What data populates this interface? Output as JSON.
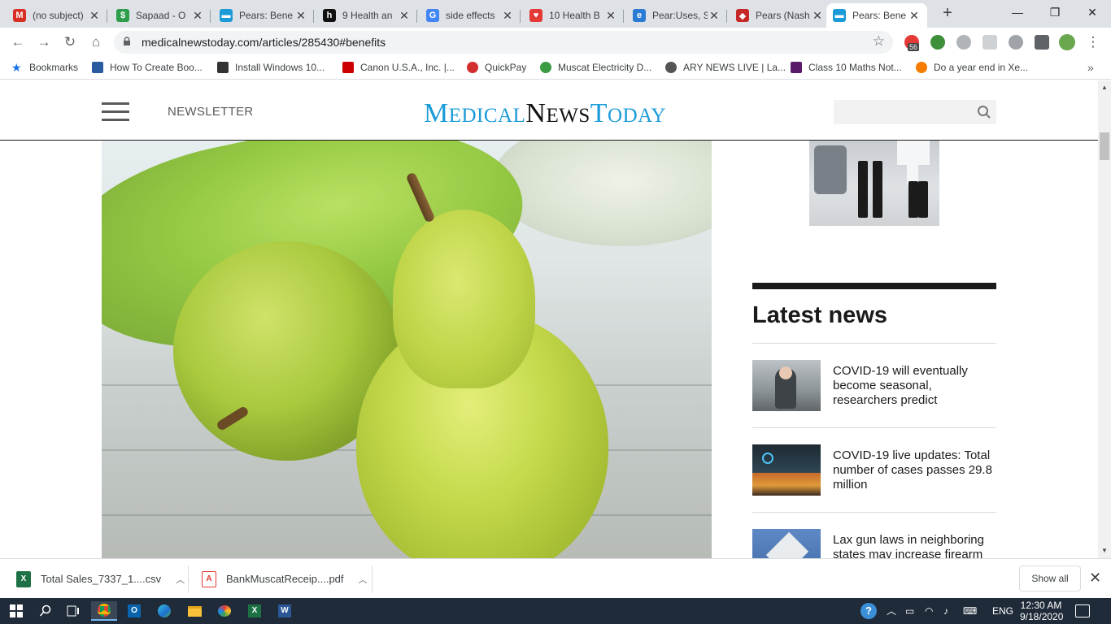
{
  "browser": {
    "tabs": [
      {
        "title": "(no subject)",
        "icon": "gmail-icon",
        "color": "#d93025",
        "glyph": "M"
      },
      {
        "title": "Sapaad - O",
        "icon": "sapaad-icon",
        "color": "#2e9e4a",
        "glyph": "$"
      },
      {
        "title": "Pears: Bene",
        "icon": "mnt-icon",
        "color": "#1a9bd7",
        "glyph": "▬"
      },
      {
        "title": "9 Health an",
        "icon": "healthline-icon",
        "color": "#111111",
        "glyph": "h"
      },
      {
        "title": "side effects",
        "icon": "google-icon",
        "color": "#4285f4",
        "glyph": "G"
      },
      {
        "title": "10 Health B",
        "icon": "health-icon",
        "color": "#e53935",
        "glyph": "♥"
      },
      {
        "title": "Pear:Uses, S",
        "icon": "ie-icon",
        "color": "#2a7bd4",
        "glyph": "e"
      },
      {
        "title": "Pears (Nash",
        "icon": "diamond-icon",
        "color": "#c62828",
        "glyph": "◆"
      },
      {
        "title": "Pears: Bene",
        "icon": "mnt-icon",
        "color": "#1a9bd7",
        "glyph": "▬"
      }
    ],
    "active_tab": 8,
    "url": "medicalnewstoday.com/articles/285430#benefits",
    "ext_badge": "56",
    "bookmarks": [
      {
        "label": "Bookmarks",
        "icon": "star-icon",
        "color": "#1a73e8"
      },
      {
        "label": "How To Create Boo...",
        "icon": "b-icon",
        "color": "#2a5aa0"
      },
      {
        "label": "Install Windows 10...",
        "icon": "doc-icon",
        "color": "#333333"
      },
      {
        "label": "Canon U.S.A., Inc. |...",
        "icon": "canon-icon",
        "color": "#cc0000"
      },
      {
        "label": "QuickPay",
        "icon": "quickpay-icon",
        "color": "#d32f2f"
      },
      {
        "label": "Muscat Electricity D...",
        "icon": "muscat-icon",
        "color": "#3a9b43"
      },
      {
        "label": "ARY NEWS LIVE | La...",
        "icon": "globe-icon",
        "color": "#555555"
      },
      {
        "label": "Class 10 Maths Not...",
        "icon": "notes-icon",
        "color": "#5a1a6a"
      },
      {
        "label": "Do a year end in Xe...",
        "icon": "xero-icon",
        "color": "#f57c00"
      }
    ]
  },
  "site": {
    "newsletter": "NEWSLETTER",
    "logo": {
      "m": "M",
      "edical": "EDICAL",
      "n": "N",
      "ews": "EWS",
      "t": "T",
      "oday": "ODAY"
    },
    "latest_title": "Latest news",
    "news": [
      {
        "title": "COVID-19 will eventually become seasonal, researchers predict"
      },
      {
        "title": "COVID-19 live updates: Total number of cases passes 29.8 million"
      },
      {
        "title": "Lax gun laws in neighboring states may increase firearm"
      }
    ]
  },
  "downloads": {
    "items": [
      {
        "name": "Total Sales_7337_1....csv",
        "icon": "excel-icon",
        "color": "#1e7145"
      },
      {
        "name": "BankMuscatReceip....pdf",
        "icon": "pdf-icon",
        "color": "#e53935"
      }
    ],
    "show_all": "Show all"
  },
  "taskbar": {
    "lang": "ENG",
    "time": "12:30 AM",
    "date": "9/18/2020"
  }
}
